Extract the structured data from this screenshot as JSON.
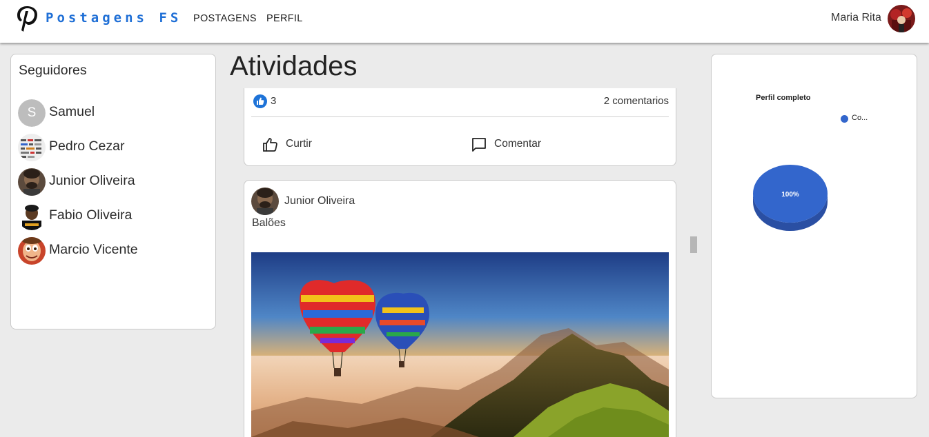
{
  "header": {
    "brand": "Postagens FS",
    "nav": [
      "POSTAGENS",
      "PERFIL"
    ],
    "user_name": "Maria Rita",
    "logo_icon": "pinterest-p-logo"
  },
  "followers": {
    "title": "Seguidores",
    "items": [
      {
        "name": "Samuel",
        "initial": "S"
      },
      {
        "name": "Pedro Cezar"
      },
      {
        "name": "Junior Oliveira"
      },
      {
        "name": "Fabio Oliveira"
      },
      {
        "name": "Marcio Vicente"
      }
    ]
  },
  "main": {
    "heading": "Atividades",
    "post1": {
      "likes": "3",
      "comments": "2 comentarios",
      "like_label": "Curtir",
      "comment_label": "Comentar"
    },
    "post2": {
      "author": "Junior Oliveira",
      "caption": "Balões"
    }
  },
  "chart_data": {
    "type": "pie",
    "title": "Perfil completo",
    "legend": [
      "Co..."
    ],
    "slices": [
      {
        "label": "Co...",
        "value": 100,
        "display": "100%"
      }
    ],
    "colors": [
      "#3366cc"
    ],
    "legend_position": "top-right",
    "three_d": true
  },
  "colors": {
    "brand": "#1f6fd6",
    "pie": "#3366cc",
    "like_badge": "#1e73d8"
  }
}
